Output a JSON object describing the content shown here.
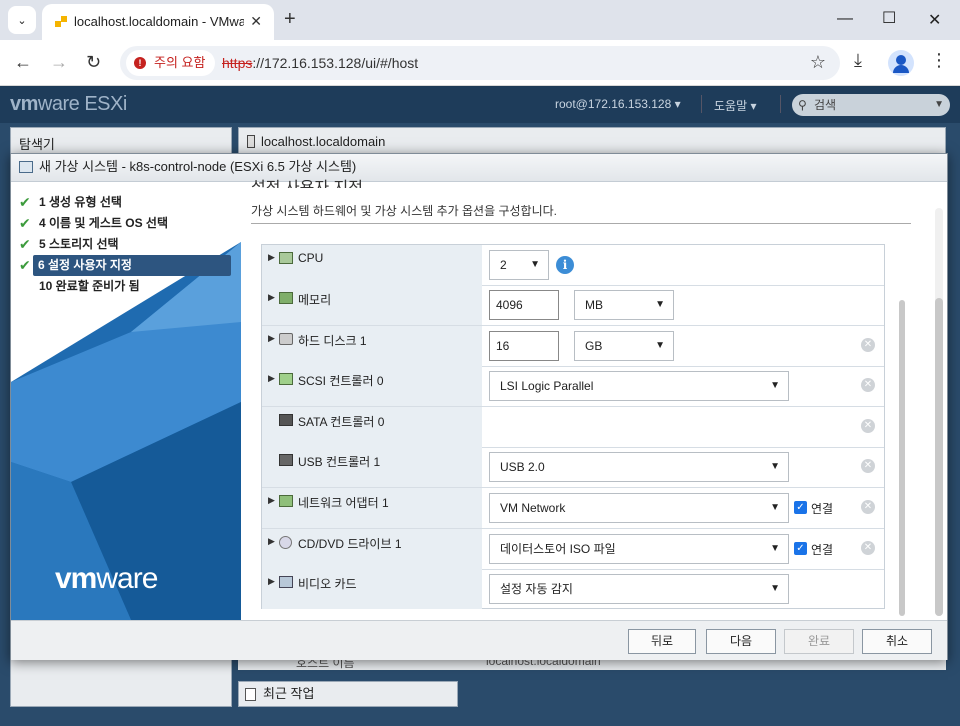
{
  "browser": {
    "tab_title": "localhost.localdomain - VMware ESXi",
    "security_chip": "주의 요함",
    "url_scheme": "https",
    "url_rest": "://172.16.153.128/ui/#/host"
  },
  "esxi": {
    "logo_brand": "vm",
    "logo_rest": "ware",
    "logo_product": "ESXi",
    "user": "root@172.16.153.128 ▾",
    "help": "도움말 ▾",
    "search_placeholder": "검색",
    "navigator_title": "탐색기",
    "host_title": "localhost.localdomain",
    "bg_row_label": "호스트 이름",
    "bg_row_value": "localhost.localdomain",
    "recent_tasks": "최근 작업"
  },
  "modal": {
    "title": "새 가상 시스템 - k8s-control-node (ESXi 6.5 가상 시스템)",
    "steps": [
      {
        "label": "1 생성 유형 선택",
        "done": true
      },
      {
        "label": "4 이름 및 게스트 OS 선택",
        "done": true
      },
      {
        "label": "5 스토리지 선택",
        "done": true
      },
      {
        "label": "6 설정 사용자 지정",
        "done": true
      },
      {
        "label": "10 완료할 준비가 됨",
        "done": false
      }
    ],
    "brand_vm": "vm",
    "brand_ware": "ware",
    "section_heading": "설정 사용자 지정",
    "section_desc": "가상 시스템 하드웨어 및 가상 시스템 추가 옵션을 구성합니다.",
    "hardware": {
      "cpu": {
        "name": "CPU",
        "value": "2"
      },
      "memory": {
        "name": "메모리",
        "value": "4096",
        "unit": "MB"
      },
      "disk": {
        "name": "하드 디스크 1",
        "value": "16",
        "unit": "GB"
      },
      "scsi": {
        "name": "SCSI 컨트롤러 0",
        "value": "LSI Logic Parallel"
      },
      "sata": {
        "name": "SATA 컨트롤러 0"
      },
      "usb": {
        "name": "USB 컨트롤러 1",
        "value": "USB 2.0"
      },
      "nic": {
        "name": "네트워크 어댑터 1",
        "value": "VM Network",
        "connect": "연결"
      },
      "cd": {
        "name": "CD/DVD 드라이브 1",
        "value": "데이터스토어 ISO 파일",
        "connect": "연결"
      },
      "video": {
        "name": "비디오 카드",
        "value": "설정 자동 감지"
      }
    },
    "buttons": {
      "back": "뒤로",
      "next": "다음",
      "finish": "완료",
      "cancel": "취소"
    }
  }
}
